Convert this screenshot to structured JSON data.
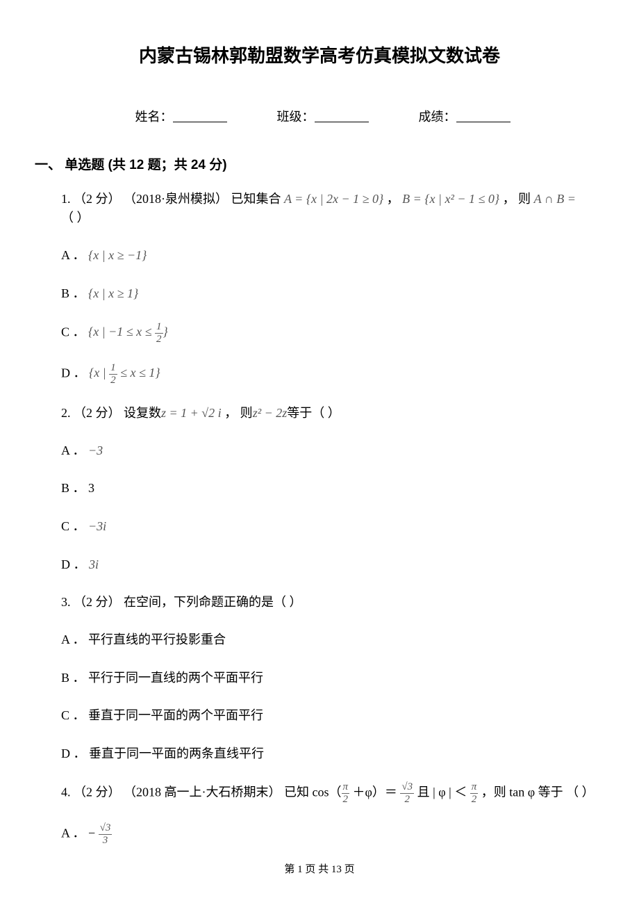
{
  "title": "内蒙古锡林郭勒盟数学高考仿真模拟文数试卷",
  "info": {
    "name_label": "姓名：",
    "class_label": "班级：",
    "score_label": "成绩："
  },
  "section1": {
    "header": "一、 单选题 (共 12 题；共 24 分)"
  },
  "q1": {
    "num": "1.",
    "points": " （2 分） ",
    "src": "（2018·泉州模拟） 已知集合 ",
    "setA": "A = {x | 2x − 1 ≥ 0}",
    "comma": " ，  ",
    "setB": "B = {x | x² − 1 ≤ 0}",
    "after": " ， 则 ",
    "AinterB": "A ∩ B = ",
    "paren": "  （     ）",
    "optA": "A ． ",
    "optA_math": "{x | x ≥ −1}",
    "optB": "B ． ",
    "optB_math": "{x | x ≥ 1}",
    "optC": "C ． ",
    "optC_math_pre": "{x | −1 ≤ x ≤ ",
    "optC_math_post": "}",
    "optD": "D ． ",
    "optD_math_pre": "{x | ",
    "optD_math_post": " ≤ x ≤ 1}"
  },
  "q2": {
    "num": "2.",
    "points": " （2 分）  设复数",
    "z": "z = 1 + √2 i",
    "mid": " ，  则",
    "expr": "z² − 2z",
    "after": "等于（     ）",
    "optA": "A ． ",
    "optA_val": "−3",
    "optB": "B ． 3",
    "optC": "C ． ",
    "optC_val": "−3i",
    "optD": "D ． ",
    "optD_val": "3i"
  },
  "q3": {
    "num": "3.",
    "points": " （2 分）  在空间，下列命题正确的是（     ）",
    "optA": "A ． 平行直线的平行投影重合",
    "optB": "B ． 平行于同一直线的两个平面平行",
    "optC": "C ． 垂直于同一平面的两个平面平行",
    "optD": "D ． 垂直于同一平面的两条直线平行"
  },
  "q4": {
    "num": "4.",
    "points": " （2 分） （2018 高一上·大石桥期末） 已知 cos（",
    "plusphi": " ＋φ）＝ ",
    "and": "  且  | φ | ＜ ",
    "then": " ，则 tan φ 等于  （     ）",
    "optA": "A ． − "
  },
  "footer": "第 1 页 共 13 页"
}
